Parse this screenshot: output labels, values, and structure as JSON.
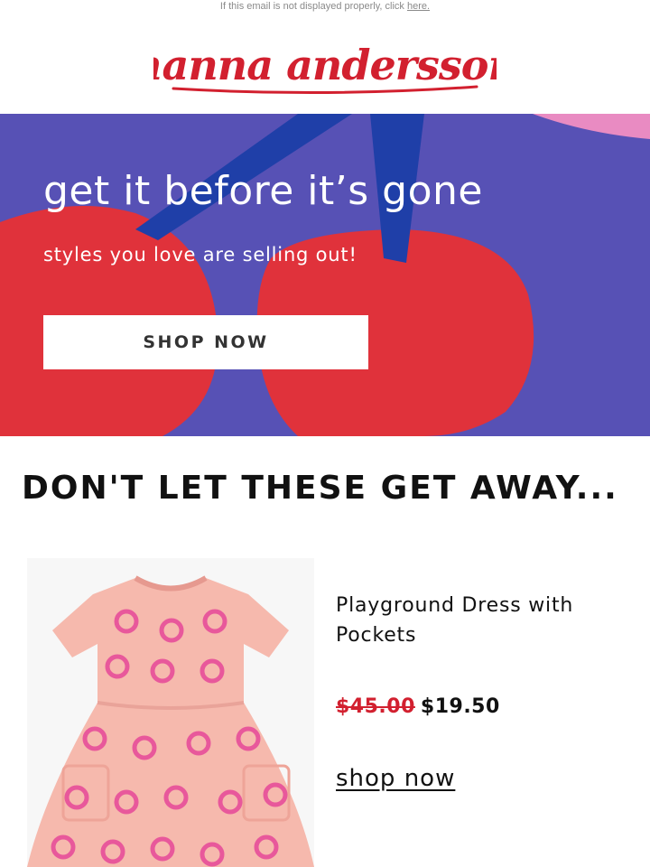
{
  "preheader": {
    "text": "If this email is not displayed properly, click",
    "link": "here."
  },
  "brand": {
    "logo_text": "hanna andersson",
    "color": "#d2202f"
  },
  "hero": {
    "title": "get it before it’s gone",
    "subtitle": "styles you love are selling out!",
    "button_label": "SHOP NOW",
    "colors": {
      "background": "#5751b5",
      "cherry": "#e0323b",
      "stem": "#1f3fa8",
      "accent": "#e98bc2"
    }
  },
  "section": {
    "title": "DON'T LET THESE GET AWAY..."
  },
  "product": {
    "name": "Playground Dress with Pockets",
    "original_price": "$45.00",
    "sale_price": "$19.50",
    "link_label": "shop now",
    "image_icon": "pink-dress-pretzel-print"
  }
}
